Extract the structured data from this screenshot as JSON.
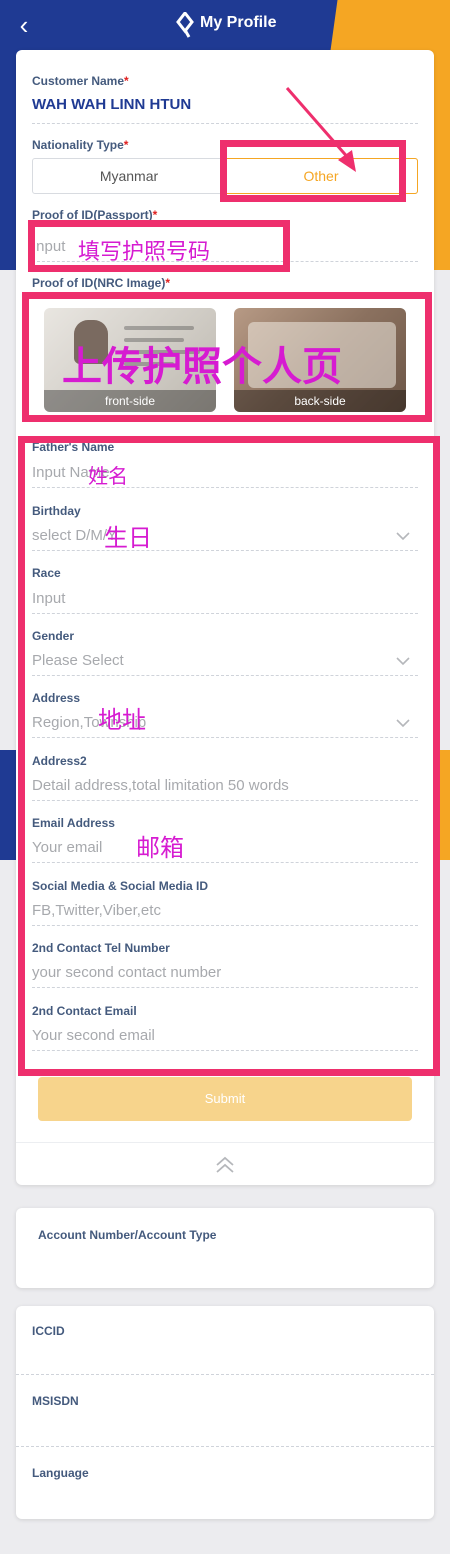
{
  "header": {
    "title": "My Profile"
  },
  "form": {
    "customer_name_label": "Customer Name",
    "customer_name_value": "WAH WAH LINN HTUN",
    "nationality_label": "Nationality Type",
    "nationality_options": [
      "Myanmar",
      "Other"
    ],
    "nationality_selected": "Other",
    "passport_label": "Proof of ID(Passport)",
    "passport_placeholder": "Input",
    "nrc_label": "Proof of ID(NRC Image)",
    "front_side": "front-side",
    "back_side": "back-side",
    "fields": [
      {
        "label": "Father's Name",
        "placeholder": "Input Name",
        "dropdown": false
      },
      {
        "label": "Birthday",
        "placeholder": "select D/M/Y",
        "dropdown": true
      },
      {
        "label": "Race",
        "placeholder": "Input",
        "dropdown": false
      },
      {
        "label": "Gender",
        "placeholder": "Please Select",
        "dropdown": true
      },
      {
        "label": "Address",
        "placeholder": "Region,Township",
        "dropdown": true
      },
      {
        "label": "Address2",
        "placeholder": "Detail address,total limitation 50 words",
        "dropdown": false
      },
      {
        "label": "Email Address",
        "placeholder": "Your email",
        "dropdown": false
      },
      {
        "label": "Social Media & Social Media ID",
        "placeholder": "FB,Twitter,Viber,etc",
        "dropdown": false
      },
      {
        "label": "2nd Contact Tel Number",
        "placeholder": "your second contact number",
        "dropdown": false
      },
      {
        "label": "2nd Contact Email",
        "placeholder": "Your second email",
        "dropdown": false
      }
    ],
    "submit_label": "Submit"
  },
  "account": {
    "label": "Account Number/Account Type"
  },
  "sim": {
    "iccid_label": "ICCID",
    "msisdn_label": "MSISDN",
    "language_label": "Language"
  },
  "annotations": {
    "passport_note": "填写护照号码",
    "upload_note": "上传护照个人页",
    "name_note": "姓名",
    "birthday_note": "生日",
    "address_note": "地址",
    "email_note": "邮箱"
  },
  "colors": {
    "brand_blue": "#1f3a93",
    "brand_yellow": "#f5a623",
    "annotation_red": "#ee2f6d",
    "annotation_text": "#d61bd1"
  }
}
